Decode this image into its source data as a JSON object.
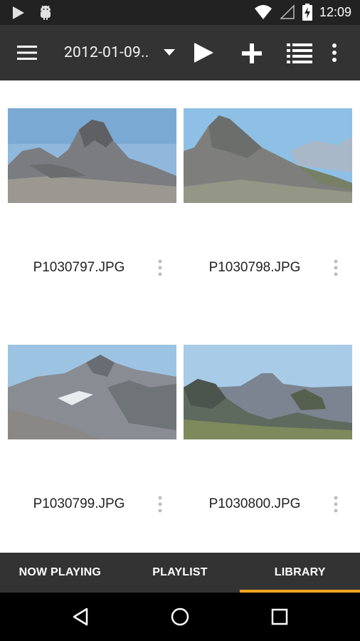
{
  "status_bar": {
    "time": "12:09"
  },
  "app_bar": {
    "title": "2012-01-09.."
  },
  "photos": [
    {
      "name": "P1030797.JPG"
    },
    {
      "name": "P1030798.JPG"
    },
    {
      "name": "P1030799.JPG"
    },
    {
      "name": "P1030800.JPG"
    }
  ],
  "tabs": [
    {
      "label": "NOW PLAYING"
    },
    {
      "label": "PLAYLIST"
    },
    {
      "label": "LIBRARY"
    }
  ],
  "colors": {
    "app_bar": "#333333",
    "status_bar": "#222222",
    "active_tab_indicator": "#f5a623"
  }
}
